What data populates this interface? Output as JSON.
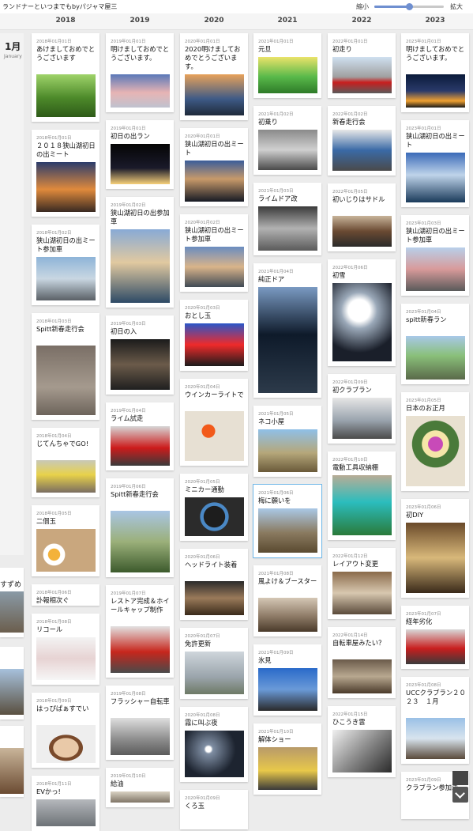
{
  "site": {
    "title": "ランドナーといつまでもbyパジャマ屋三",
    "zoom_out_label": "縮小",
    "zoom_in_label": "拡大",
    "zoom_level": 0.5
  },
  "years": [
    "2018",
    "2019",
    "2020",
    "2021",
    "2022",
    "2023"
  ],
  "month": {
    "jp": "1月",
    "en": "January"
  },
  "sliver_items": [
    {
      "title": "すずめ"
    }
  ],
  "columns": [
    {
      "year": "2018",
      "cards": [
        {
          "date": "2018年01月01日",
          "title": "あけましておめでとうございます",
          "img": "green-park",
          "h": 112
        },
        {
          "date": "2018年01月01日",
          "title": "２０１８狭山湖初日の出ミート",
          "img": "sunrise",
          "h": 110
        },
        {
          "date": "2018年01月02日",
          "title": "狭山湖初日の出ミート参加車",
          "img": "bikes-rail",
          "h": 102
        },
        {
          "date": "2018年01月03日",
          "title": "Spitt新春走行会",
          "img": "bike-shadow",
          "h": 135
        },
        {
          "date": "2018年01月04日",
          "title": "じてんちゃでGO!",
          "img": "kid-bike",
          "h": 88
        },
        {
          "date": "2018年01月05日",
          "title": "二個玉",
          "img": "eggs",
          "h": 90
        },
        {
          "date": "2018年01月06日",
          "title": "訃報相次ぐ",
          "img": "none",
          "h": 27
        },
        {
          "date": "2018年01月08日",
          "title": "リコール",
          "img": "paper",
          "h": 90
        },
        {
          "date": "2018年01月09日",
          "title": "はっぴぱぁすでい",
          "img": "cake",
          "h": 95
        },
        {
          "date": "2018年01月11日",
          "title": "EVかっ!",
          "img": "car-white",
          "h": 70
        }
      ]
    },
    {
      "year": "2019",
      "cards": [
        {
          "date": "2019年01月01日",
          "title": "明けましておめでとうございます。",
          "img": "mt-fuji",
          "h": 100
        },
        {
          "date": "2019年01月01日",
          "title": "初日の出ラン",
          "img": "night-road",
          "h": 87
        },
        {
          "date": "2019年01月02日",
          "title": "狭山湖初日の出参加車",
          "img": "bike-lake",
          "h": 140
        },
        {
          "date": "2019年01月03日",
          "title": "初日の入",
          "img": "cockpit",
          "h": 100
        },
        {
          "date": "2019年01月04日",
          "title": "ライム試走",
          "img": "red-car",
          "h": 86
        },
        {
          "date": "2019年01月06日",
          "title": "Spitt新春走行会",
          "img": "green-bike",
          "h": 125
        },
        {
          "date": "2019年01月07日",
          "title": "レストア完成＆ホイールキャップ制作",
          "img": "red-car2",
          "h": 117
        },
        {
          "date": "2019年01月08日",
          "title": "フラッシャー自転車",
          "img": "flash-bike",
          "h": 94
        },
        {
          "date": "2019年01月10日",
          "title": "給油",
          "img": "gas",
          "h": 50
        }
      ]
    },
    {
      "year": "2020",
      "cards": [
        {
          "date": "2020年01月01日",
          "title": "2020明けましておめでとうございます。",
          "img": "bike-sun",
          "h": 110
        },
        {
          "date": "2020年01月01日",
          "title": "狭山湖初日の出ミート",
          "img": "dusk-lake",
          "h": 99
        },
        {
          "date": "2020年01月02日",
          "title": "狭山湖初日の出ミート参加車",
          "img": "bikes-dusk",
          "h": 98
        },
        {
          "date": "2020年01月03日",
          "title": "おとし玉",
          "img": "tv",
          "h": 90
        },
        {
          "date": "2020年01月04日",
          "title": "ウインカーライトで",
          "img": "lights",
          "h": 110
        },
        {
          "date": "2020年01月05日",
          "title": "ミニカー通勤",
          "img": "steering",
          "h": 85
        },
        {
          "date": "2020年01月06日",
          "title": "ヘッドライト装着",
          "img": "headlight",
          "h": 90
        },
        {
          "date": "2020年01月07日",
          "title": "免許更新",
          "img": "building",
          "h": 90
        },
        {
          "date": "2020年01月08日",
          "title": "霧に叫ぶ夜",
          "img": "fog",
          "h": 95
        },
        {
          "date": "2020年01月09日",
          "title": "くろ玉",
          "img": "none",
          "h": 50
        }
      ]
    },
    {
      "year": "2021",
      "cards": [
        {
          "date": "2021年01月01日",
          "title": "元旦",
          "img": "new-year",
          "h": 82
        },
        {
          "date": "2021年01月02日",
          "title": "初乗り",
          "img": "bikes-grey",
          "h": 87
        },
        {
          "date": "2021年01月03日",
          "title": "ライムドア改",
          "img": "keyboard",
          "h": 92
        },
        {
          "date": "2021年01月04日",
          "title": "純正ドア",
          "img": "car-door",
          "h": 170
        },
        {
          "date": "2021年01月05日",
          "title": "ネコ小屋",
          "img": "palm",
          "h": 90
        },
        {
          "date": "2021年01月06日",
          "title": "梅に願いを",
          "img": "field-tree",
          "h": 92,
          "hl": true
        },
        {
          "date": "2021年01月08日",
          "title": "風よけ＆ブースター",
          "img": "garage",
          "h": 90
        },
        {
          "date": "2021年01月09日",
          "title": "氷見",
          "img": "blue-sky",
          "h": 90
        },
        {
          "date": "2021年01月10日",
          "title": "解体ショー",
          "img": "garage2",
          "h": 90
        }
      ]
    },
    {
      "year": "2022",
      "cards": [
        {
          "date": "2022年01月01日",
          "title": "初走り",
          "img": "red-road",
          "h": 82
        },
        {
          "date": "2022年01月02日",
          "title": "新春走行会",
          "img": "shop",
          "h": 88
        },
        {
          "date": "2022年01月05日",
          "title": "初いじりはサドル",
          "img": "saddle",
          "h": 86
        },
        {
          "date": "2022年01月06日",
          "title": "初雪",
          "img": "snow-tree",
          "h": 135
        },
        {
          "date": "2022年01月09日",
          "title": "初クラブラン",
          "img": "street",
          "h": 88
        },
        {
          "date": "2022年01月10日",
          "title": "電動工具収納棚",
          "img": "blue-rack",
          "h": 112
        },
        {
          "date": "2022年01月12日",
          "title": "レイアウト変更",
          "img": "workshop",
          "h": 90
        },
        {
          "date": "2022年01月14日",
          "title": "自転車屋みたい？",
          "img": "workshop2",
          "h": 90
        },
        {
          "date": "2022年01月15日",
          "title": "ひこうき雲",
          "img": "silver",
          "h": 90
        }
      ]
    },
    {
      "year": "2023",
      "cards": [
        {
          "date": "2023年01月01日",
          "title": "明けましておめでとうございます。",
          "img": "horizon",
          "h": 100
        },
        {
          "date": "2023年01月01日",
          "title": "狭山湖初日の出ミート",
          "img": "dawn-lake",
          "h": 110
        },
        {
          "date": "2023年01月03日",
          "title": "狭山湖初日の出ミート参加車",
          "img": "bikes-rail2",
          "h": 102
        },
        {
          "date": "2023年01月04日",
          "title": "spitt新春ラン",
          "img": "green-bike2",
          "h": 102
        },
        {
          "date": "2023年01月05日",
          "title": "日本のお正月",
          "img": "flowers",
          "h": 125
        },
        {
          "date": "2023年01月06日",
          "title": "初DIY",
          "img": "diy",
          "h": 125
        },
        {
          "date": "2023年01月07日",
          "title": "経年劣化",
          "img": "red-car3",
          "h": 80
        },
        {
          "date": "2023年01月08日",
          "title": "UCCクラブラン２０２３　１月",
          "img": "park",
          "h": 110
        },
        {
          "date": "2023年01月09日",
          "title": "クラブラン参加車",
          "img": "none",
          "h": 60
        }
      ]
    }
  ]
}
